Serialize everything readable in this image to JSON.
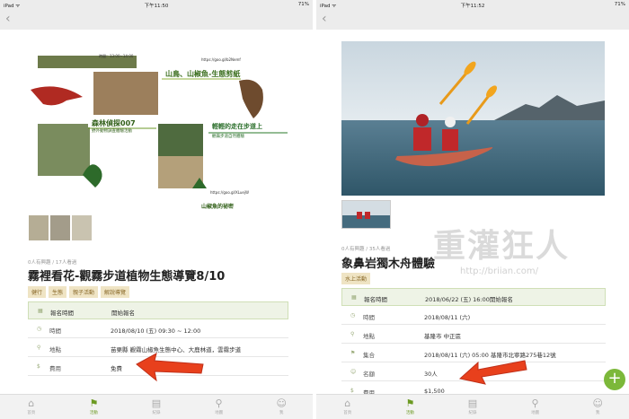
{
  "left": {
    "status": {
      "device": "iPad ᯤ",
      "time": "下午11:50",
      "battery": "71%"
    },
    "poster": {
      "heading1": "山鳥、山椒魚-生態剪紙",
      "heading2": "森林偵探007",
      "heading3": "輕輕的走在步道上",
      "subhead2": "野外動物調查體驗活動",
      "subhead3": "觀霧步道自然體驗",
      "link1": "https://goo.gl/b2Nemf",
      "link2": "https://goo.gl/XLuejW",
      "time1": "時間：13:00~14:00",
      "footer": "山椒魚的祕密"
    },
    "meta": "0人有興趣 / 17人看過",
    "title": "霧裡看花-觀霧步道植物生態導覽8/10",
    "tags": [
      "健行",
      "生態",
      "親子活動",
      "解說導覽"
    ],
    "rows": [
      {
        "icon": "▦",
        "key": "報名時間",
        "value": "開始報名"
      },
      {
        "icon": "◷",
        "key": "時間",
        "value": "2018/08/10 (五) 09:30 ~ 12:00"
      },
      {
        "icon": "⚲",
        "key": "地點",
        "value": "苗栗縣 觀霧山椒魚生態中心、大鹿林道，雲霧步道"
      },
      {
        "icon": "$",
        "key": "費用",
        "value": "免費"
      }
    ],
    "tabs": [
      {
        "icon": "⌂",
        "label": "首頁"
      },
      {
        "icon": "⚑",
        "label": "活動"
      },
      {
        "icon": "▤",
        "label": "紀錄"
      },
      {
        "icon": "⚲",
        "label": "地圖"
      },
      {
        "icon": "☺",
        "label": "我"
      }
    ]
  },
  "right": {
    "status": {
      "device": "iPad ᯤ",
      "time": "下午11:52",
      "battery": "71%"
    },
    "meta": "0人有興趣 / 35人看過",
    "title": "象鼻岩獨木舟體驗",
    "tags": [
      "水上活動"
    ],
    "rows": [
      {
        "icon": "▦",
        "key": "報名時間",
        "value": "2018/06/22 (五) 16:00開始報名"
      },
      {
        "icon": "◷",
        "key": "時間",
        "value": "2018/08/11 (六)"
      },
      {
        "icon": "⚲",
        "key": "地點",
        "value": "基隆市 中正區"
      },
      {
        "icon": "⚑",
        "key": "集合",
        "value": "2018/08/11 (六) 05:00 基隆市北寧路275巷12號"
      },
      {
        "icon": "☺",
        "key": "名額",
        "value": "30人"
      },
      {
        "icon": "$",
        "key": "費用",
        "value": "$1,500"
      }
    ],
    "tabs": [
      {
        "icon": "⌂",
        "label": "首頁"
      },
      {
        "icon": "⚑",
        "label": "活動"
      },
      {
        "icon": "▤",
        "label": "紀錄"
      },
      {
        "icon": "⚲",
        "label": "地圖"
      },
      {
        "icon": "☺",
        "label": "我"
      }
    ],
    "fab": "+",
    "watermark": {
      "cn": "重灌狂人",
      "url": "http://briian.com/"
    }
  },
  "colors": {
    "accent": "#6c9a22",
    "arrow": "#e8401c",
    "tag_bg": "#efe4c4"
  }
}
